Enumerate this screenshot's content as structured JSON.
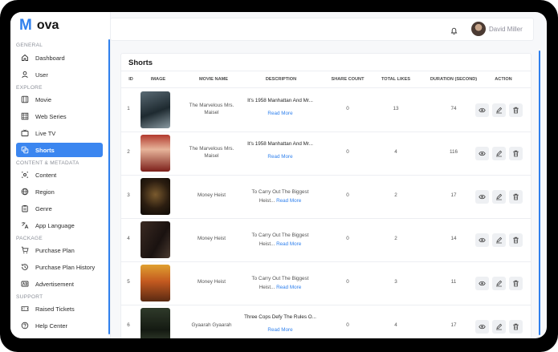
{
  "app": {
    "name_m": "M",
    "name_rest": "ova"
  },
  "header": {
    "user_name": "David Miller"
  },
  "sidebar": {
    "sections": [
      "GENERAL",
      "EXPLORE",
      "CONTENT & METADATA",
      "PACKAGE",
      "SUPPORT"
    ],
    "items": [
      {
        "label": "Dashboard",
        "icon": "home-icon"
      },
      {
        "label": "User",
        "icon": "user-icon"
      },
      {
        "label": "Movie",
        "icon": "film-icon"
      },
      {
        "label": "Web Series",
        "icon": "film-strip-icon"
      },
      {
        "label": "Live TV",
        "icon": "tv-icon"
      },
      {
        "label": "Shorts",
        "icon": "shorts-icon",
        "active": true
      },
      {
        "label": "Content",
        "icon": "content-icon"
      },
      {
        "label": "Region",
        "icon": "globe-icon"
      },
      {
        "label": "Genre",
        "icon": "clipboard-icon"
      },
      {
        "label": "App Language",
        "icon": "translate-icon"
      },
      {
        "label": "Purchase Plan",
        "icon": "cart-icon"
      },
      {
        "label": "Purchase Plan History",
        "icon": "history-icon"
      },
      {
        "label": "Advertisement",
        "icon": "ad-icon"
      },
      {
        "label": "Raised Tickets",
        "icon": "ticket-icon"
      },
      {
        "label": "Help Center",
        "icon": "help-icon"
      }
    ]
  },
  "page": {
    "title": "Shorts"
  },
  "table": {
    "headers": [
      "ID",
      "IMAGE",
      "MOVIE NAME",
      "DESCRIPTION",
      "SHARE COUNT",
      "TOTAL LIKES",
      "DURATION (SECOND)",
      "ACTION"
    ],
    "read_more": "Read More",
    "rows": [
      {
        "id": "1",
        "movie_name_1": "The Marvelous Mrs.",
        "movie_name_2": "Maisel",
        "description": "It's 1958 Manhattan And Mr...",
        "share": "0",
        "likes": "13",
        "duration": "74"
      },
      {
        "id": "2",
        "movie_name_1": "The Marvelous Mrs.",
        "movie_name_2": "Maisel",
        "description": "It's 1958 Manhattan And Mr...",
        "share": "0",
        "likes": "4",
        "duration": "116"
      },
      {
        "id": "3",
        "movie_name_1": "Money Heist",
        "movie_name_2": "",
        "desc_line1": "To Carry Out The Biggest",
        "desc_line2": "Heist...",
        "share": "0",
        "likes": "2",
        "duration": "17"
      },
      {
        "id": "4",
        "movie_name_1": "Money Heist",
        "movie_name_2": "",
        "desc_line1": "To Carry Out The Biggest",
        "desc_line2": "Heist...",
        "share": "0",
        "likes": "2",
        "duration": "14"
      },
      {
        "id": "5",
        "movie_name_1": "Money Heist",
        "movie_name_2": "",
        "desc_line1": "To Carry Out The Biggest",
        "desc_line2": "Heist...",
        "share": "0",
        "likes": "3",
        "duration": "11"
      },
      {
        "id": "6",
        "movie_name_1": "Gyaarah Gyaarah",
        "movie_name_2": "",
        "description": "Three Cops Defy The Rules O...",
        "share": "0",
        "likes": "4",
        "duration": "17"
      }
    ]
  },
  "colors": {
    "accent": "#3b86f0",
    "link": "#2f80ed"
  }
}
